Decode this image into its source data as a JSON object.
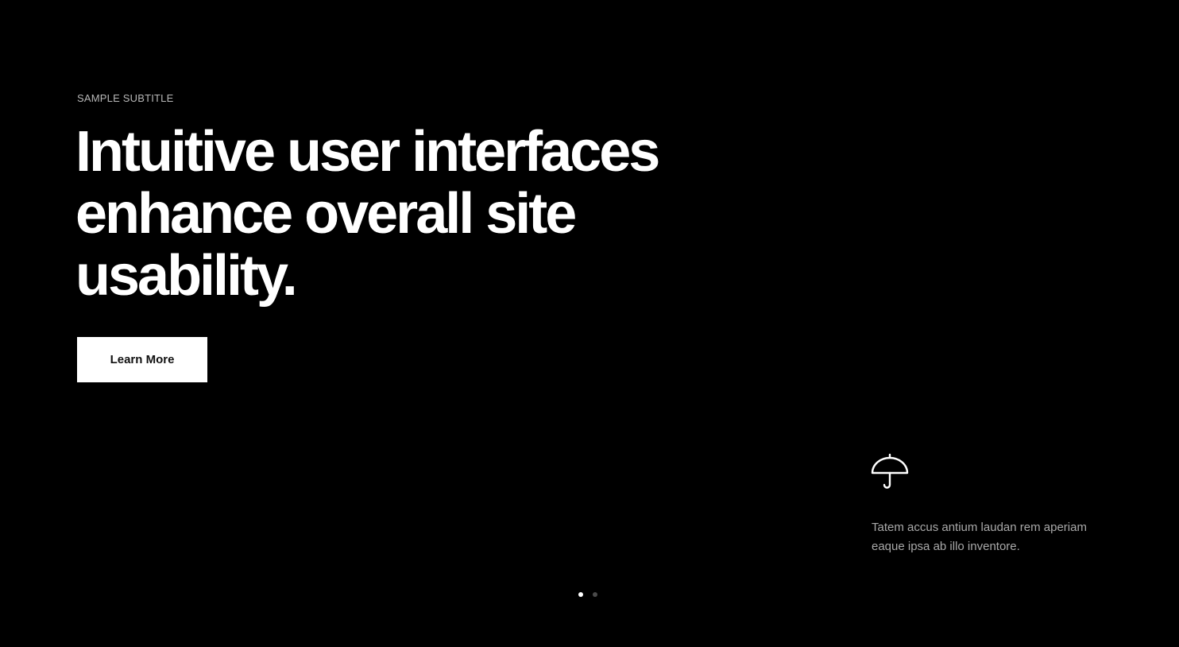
{
  "hero": {
    "subtitle": "SAMPLE SUBTITLE",
    "headline": "Intuitive user interfaces enhance overall site usability.",
    "cta_label": "Learn More"
  },
  "feature": {
    "icon": "umbrella-icon",
    "text": "Tatem accus antium laudan rem aperiam eaque ipsa ab illo inventore."
  },
  "pagination": {
    "slides": 2,
    "active_index": 0
  },
  "colors": {
    "background": "#000000",
    "headline": "#ffffff",
    "subtitle": "#b8b8b8",
    "body_text": "#a9a9a9",
    "button_bg": "#ffffff",
    "button_text": "#111111",
    "dot_active": "#ffffff",
    "dot_inactive": "#4a4a4a"
  }
}
